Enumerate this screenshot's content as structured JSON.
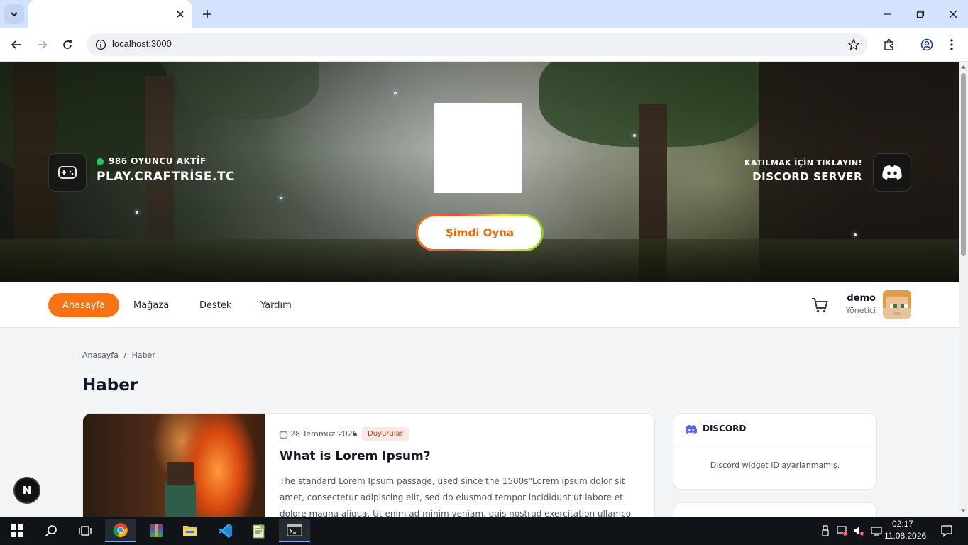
{
  "browser": {
    "tab_title": "",
    "url": "localhost:3000",
    "icons": [
      "tab-search-icon",
      "close-icon",
      "plus-icon",
      "minimize-icon",
      "restore-icon",
      "close-window-icon",
      "back-icon",
      "forward-icon",
      "reload-icon",
      "info-icon",
      "star-icon",
      "extensions-icon",
      "profile-icon",
      "menu-icon"
    ]
  },
  "hero": {
    "online_text": "986 OYUNCU AKTİF",
    "server_ip": "PLAY.CRAFTRİSE.TC",
    "discord_hint": "KATILMAK İÇİN TIKLAYIN!",
    "discord_title": "DISCORD SERVER",
    "play_button": "Şimdi Oyna",
    "online_dot_color": "#22c55e"
  },
  "nav": {
    "items": [
      {
        "label": "Anasayfa",
        "active": true
      },
      {
        "label": "Mağaza",
        "active": false
      },
      {
        "label": "Destek",
        "active": false
      },
      {
        "label": "Yardım",
        "active": false
      }
    ],
    "user": {
      "name": "demo",
      "role": "Yönetici"
    },
    "accent_color": "#f97316"
  },
  "content": {
    "breadcrumb": [
      "Anasayfa",
      "/",
      "Haber"
    ],
    "page_title": "Haber",
    "news": [
      {
        "date": "28 Temmuz 2026",
        "category": "Duyurular",
        "title": "What is Lorem Ipsum?",
        "excerpt": "The standard Lorem Ipsum passage, used since the 1500s\"Lorem ipsum dolor sit amet, consectetur adipiscing elit, sed do eiusmod tempor incididunt ut labore et dolore magna aliqua. Ut enim ad minim veniam, quis nostrud exercitation ullamco"
      }
    ],
    "discord_widget": {
      "title": "DISCORD",
      "message": "Discord widget ID ayarlanmamış."
    }
  },
  "devtools_badge": "N",
  "taskbar": {
    "time": "02:17",
    "date": "11.08.2026"
  }
}
